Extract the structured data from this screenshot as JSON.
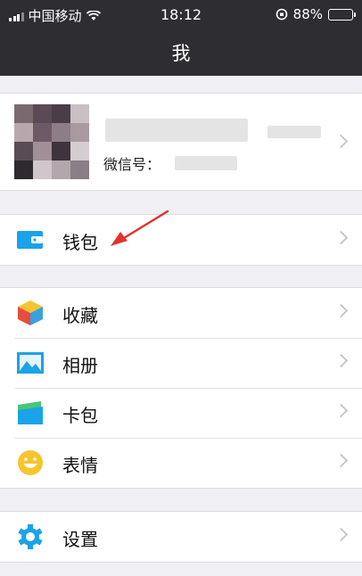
{
  "status_bar": {
    "carrier": "中国移动",
    "time": "18:12",
    "battery": "88%",
    "battery_level": 0.88
  },
  "nav": {
    "title": "我"
  },
  "profile": {
    "wechat_id_label": "微信号："
  },
  "groups": [
    {
      "items": [
        {
          "label": "钱包",
          "icon": "wallet-icon"
        }
      ]
    },
    {
      "items": [
        {
          "label": "收藏",
          "icon": "favorites-cube-icon"
        },
        {
          "label": "相册",
          "icon": "album-photo-icon"
        },
        {
          "label": "卡包",
          "icon": "card-wallet-icon"
        },
        {
          "label": "表情",
          "icon": "emoji-smiley-icon"
        }
      ]
    },
    {
      "items": [
        {
          "label": "设置",
          "icon": "settings-gear-icon"
        }
      ]
    }
  ],
  "annotation": {
    "type": "red-arrow",
    "points_to": "钱包"
  },
  "colors": {
    "header_bg": "#2e2e32",
    "page_bg": "#efeff4",
    "wallet_blue": "#1aa3e8",
    "arrow_red": "#e0322f",
    "emoji_yellow": "#f7c52b"
  }
}
